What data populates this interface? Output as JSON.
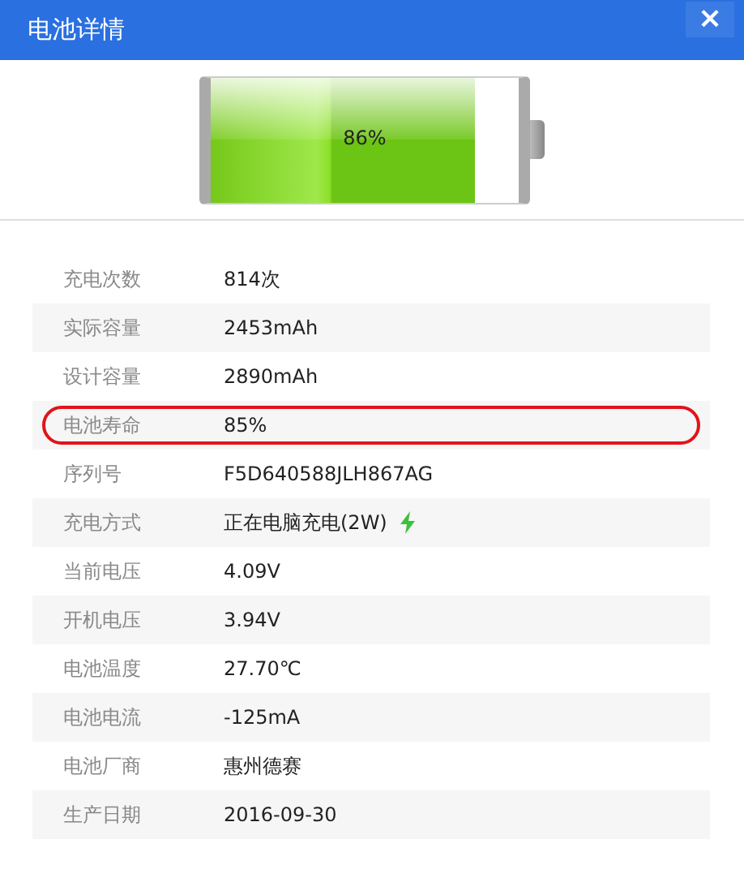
{
  "window": {
    "title": "电池详情",
    "close": "×"
  },
  "battery": {
    "reading": "86%"
  },
  "rows": [
    {
      "label": "充电次数",
      "value": "814次",
      "kind": "plain",
      "highlighted": false
    },
    {
      "label": "实际容量",
      "value": "2453mAh",
      "kind": "plain",
      "highlighted": false
    },
    {
      "label": "设计容量",
      "value": "2890mAh",
      "kind": "plain",
      "highlighted": false
    },
    {
      "label": "电池寿命",
      "value": "85%",
      "kind": "plain",
      "highlighted": true
    },
    {
      "label": "序列号",
      "value": "F5D640588JLH867AG",
      "kind": "plain",
      "highlighted": false
    },
    {
      "label": "充电方式",
      "value": "正在电脑充电(2W)",
      "kind": "charging",
      "highlighted": false
    },
    {
      "label": "当前电压",
      "value": "4.09V",
      "kind": "plain",
      "highlighted": false
    },
    {
      "label": "开机电压",
      "value": "3.94V",
      "kind": "plain",
      "highlighted": false
    },
    {
      "label": "电池温度",
      "value": "27.70℃",
      "kind": "plain",
      "highlighted": false
    },
    {
      "label": "电池电流",
      "value": "-125mA",
      "kind": "plain",
      "highlighted": false
    },
    {
      "label": "电池厂商",
      "value": "惠州德赛",
      "kind": "plain",
      "highlighted": false
    },
    {
      "label": "生产日期",
      "value": "2016-09-30",
      "kind": "plain",
      "highlighted": false
    }
  ]
}
